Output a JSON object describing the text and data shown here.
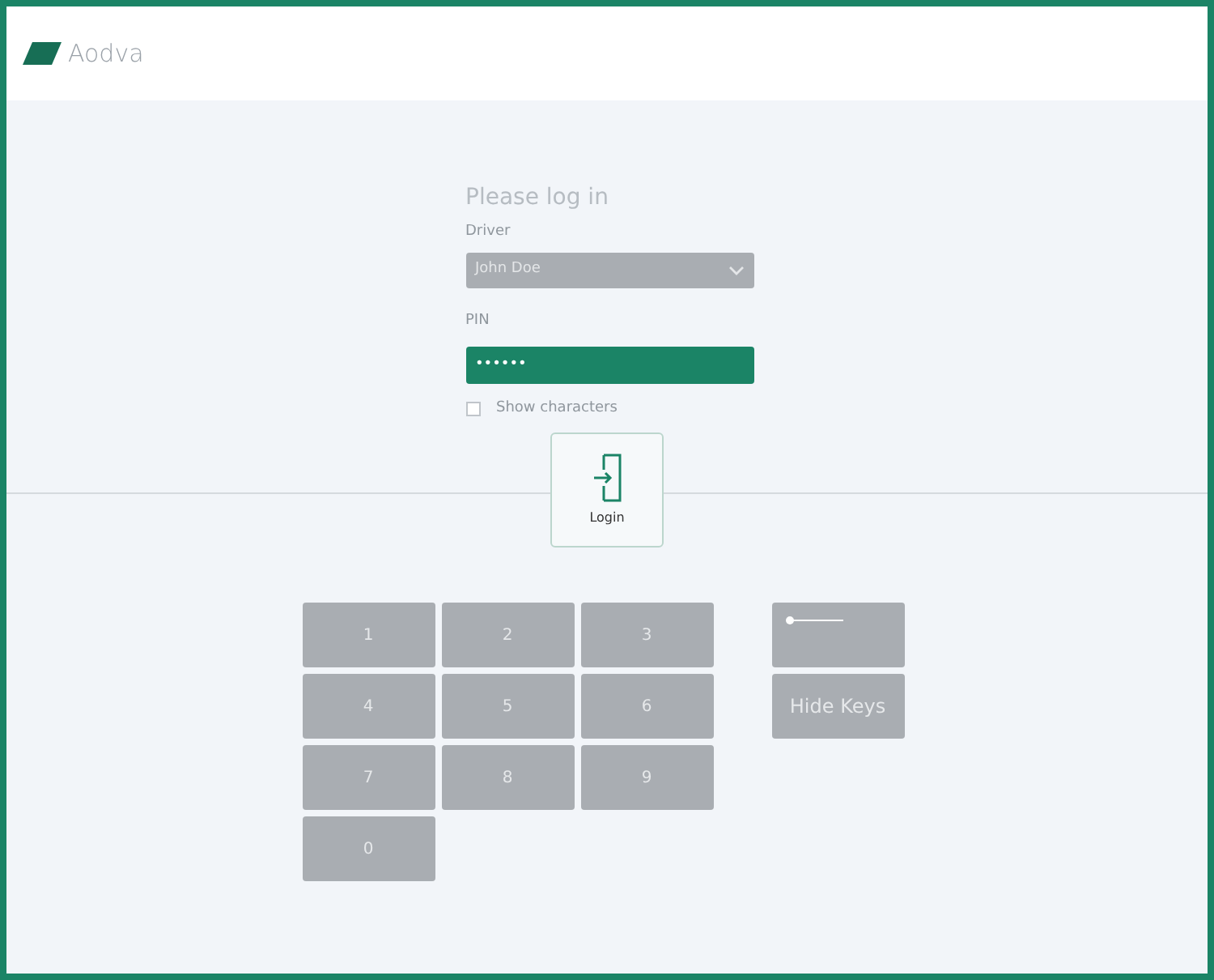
{
  "header": {
    "logo_text": "Aodva"
  },
  "form": {
    "title": "Please log in",
    "driver": {
      "label": "Driver",
      "value": "John Doe"
    },
    "pin": {
      "label": "PIN",
      "value": "••••••",
      "focused": true
    },
    "show_characters": {
      "label": "Show characters",
      "checked": false
    }
  },
  "login_button": {
    "label": "Login"
  },
  "keypad": {
    "keys": [
      "1",
      "2",
      "3",
      "4",
      "5",
      "6",
      "7",
      "8",
      "9",
      "0"
    ],
    "side_keys": [
      {
        "kind": "backspace"
      },
      {
        "kind": "text",
        "label": "Hide Keys"
      }
    ]
  }
}
